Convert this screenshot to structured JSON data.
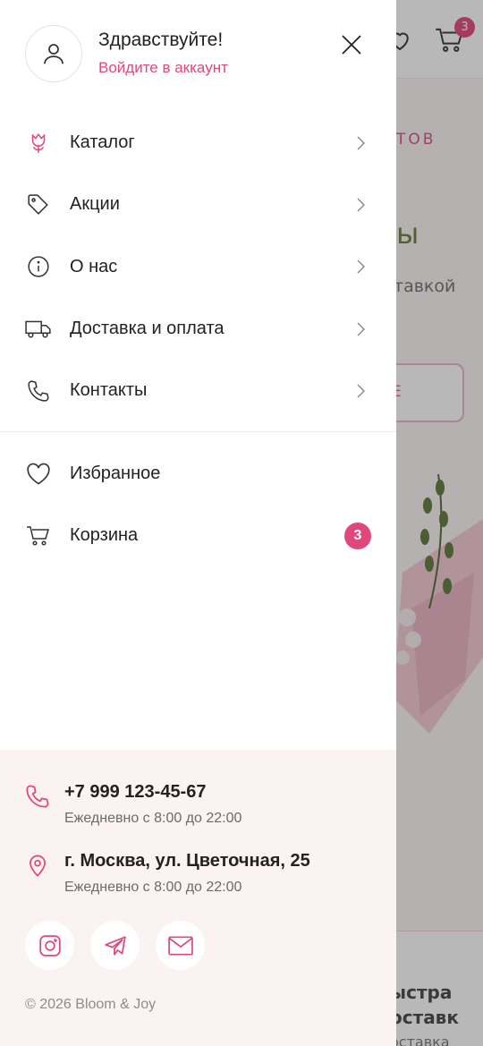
{
  "background": {
    "cart_count": "3",
    "promo_text": "ТОВ",
    "hero_title": "ы",
    "hero_subtitle": "тавкой",
    "hero_button": "Е",
    "bottom_line1": "ыстра",
    "bottom_line2": "оставк",
    "bottom_line3": "оставка"
  },
  "profile": {
    "greeting": "Здравствуйте!",
    "login_link": "Войдите в аккаунт"
  },
  "nav": {
    "items": [
      {
        "label": "Каталог"
      },
      {
        "label": "Акции"
      },
      {
        "label": "О нас"
      },
      {
        "label": "Доставка и оплата"
      },
      {
        "label": "Контакты"
      }
    ]
  },
  "nav2": {
    "favorites": "Избранное",
    "cart": "Корзина",
    "cart_badge": "3"
  },
  "footer": {
    "phone": "+7 999 123-45-67",
    "phone_hours": "Ежедневно с 8:00 до 22:00",
    "address": "г. Москва, ул. Цветочная, 25",
    "address_hours": "Ежедневно с 8:00 до 22:00",
    "copyright": "© 2026 Bloom & Joy"
  },
  "colors": {
    "accent": "#e2477b",
    "footer_bg": "#fbf2f2"
  }
}
